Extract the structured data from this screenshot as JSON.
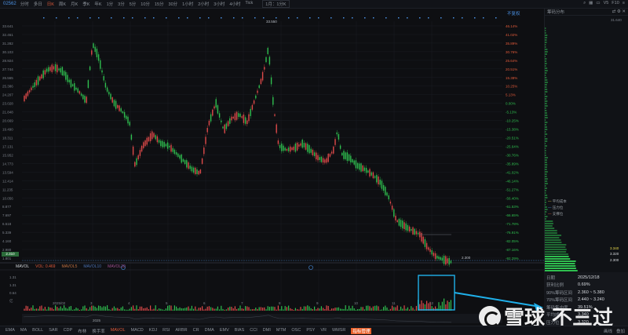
{
  "topbar": {
    "code": "02562",
    "periods": [
      "分时",
      "多日",
      "日K",
      "周K",
      "月K",
      "季K",
      "年K",
      "1分",
      "3分",
      "5分",
      "10分",
      "15分",
      "30分",
      "1小时",
      "2小时",
      "3小时",
      "4小时",
      "Tick"
    ],
    "active_period": "日K",
    "select_label": "1月：1分K",
    "right_icons": [
      "search-icon",
      "grid-icon",
      "window-icon",
      "v5",
      "f10",
      "menu-icon"
    ],
    "right_labels": [
      "V5",
      "F10"
    ]
  },
  "chart": {
    "adjust_label": "不复权",
    "high_marker": "33.550",
    "low_marker": "2.300",
    "price_ticks": [
      "33.641",
      "32.461",
      "31.282",
      "30.103",
      "28.924",
      "27.744",
      "26.565",
      "25.386",
      "24.207",
      "23.028",
      "21.848",
      "20.669",
      "19.490",
      "18.311",
      "17.131",
      "15.952",
      "14.773",
      "13.594",
      "12.414",
      "11.235",
      "10.056",
      "8.877",
      "7.697",
      "6.518",
      "5.339",
      "4.160",
      "2.980",
      "1.801"
    ],
    "pct_ticks": [
      "46.14%",
      "41.02%",
      "35.89%",
      "30.76%",
      "25.64%",
      "20.51%",
      "15.38%",
      "10.25%",
      "5.13%",
      "0.00%",
      "-5.13%",
      "-10.25%",
      "-15.38%",
      "-20.51%",
      "-25.64%",
      "-30.76%",
      "-35.89%",
      "-41.02%",
      "-46.14%",
      "-51.27%",
      "-56.40%",
      "-61.53%",
      "-66.65%",
      "-71.78%",
      "-76.91%",
      "-82.05%",
      "-87.16%",
      "-92.29%"
    ],
    "current_price_tag": "2.310"
  },
  "volume": {
    "indicator": "MAVOL",
    "vol_label": "VOL: 0.469",
    "ma5": "MAVOL5",
    "ma10": "MAVOL10",
    "ma20": "MAVOL20",
    "y_ticks": [
      "1.31",
      "1.31",
      "0.64",
      "亿"
    ]
  },
  "xaxis": {
    "labels": [
      "2025/02",
      "3",
      "4",
      "5",
      "6",
      "7",
      "8",
      "9",
      "10",
      "11",
      "12"
    ],
    "year": "2025"
  },
  "right_panel": {
    "title": "筹码分布",
    "top_value": "31.640",
    "legend": [
      "平均成本",
      "压力位",
      "支撑位"
    ],
    "price_tags": [
      "3.340",
      "3.320",
      "2.300"
    ]
  },
  "info": {
    "rows": [
      {
        "k": "日期",
        "v": "2025/12/18"
      },
      {
        "k": "获利比例",
        "v": "0.69%"
      },
      {
        "k": "90%筹码区间",
        "v": "2.360 ~ 5.380"
      },
      {
        "k": "70%筹码区间",
        "v": "2.440 ~ 3.240"
      },
      {
        "k": "筹码集中度",
        "v": "39.51%"
      },
      {
        "k": "平均成本",
        "v": "3.340"
      },
      {
        "k": "压力位",
        "v": "3.320"
      }
    ]
  },
  "bottom_toolbar": {
    "indicators": [
      "EMA",
      "MA",
      "BOLL",
      "SAR",
      "CDP",
      "布林",
      "换手率",
      "MAVOL",
      "MACD",
      "KDJ",
      "RSI",
      "ARBR",
      "CR",
      "DMA",
      "EMV",
      "BIAS",
      "CCI",
      "DMI",
      "MTM",
      "OSC",
      "PSY",
      "VR",
      "WMSR",
      "指标管理"
    ],
    "active": "MAVOL",
    "right": [
      "画线",
      "叠加"
    ]
  },
  "watermark": {
    "text": "雪球 不三过"
  },
  "colors": {
    "up": "#e04a4a",
    "down": "#2fbf4f",
    "accent": "#e05a3a",
    "highlight_box": "#1fb0ea",
    "bg": "#0e0f12"
  }
}
